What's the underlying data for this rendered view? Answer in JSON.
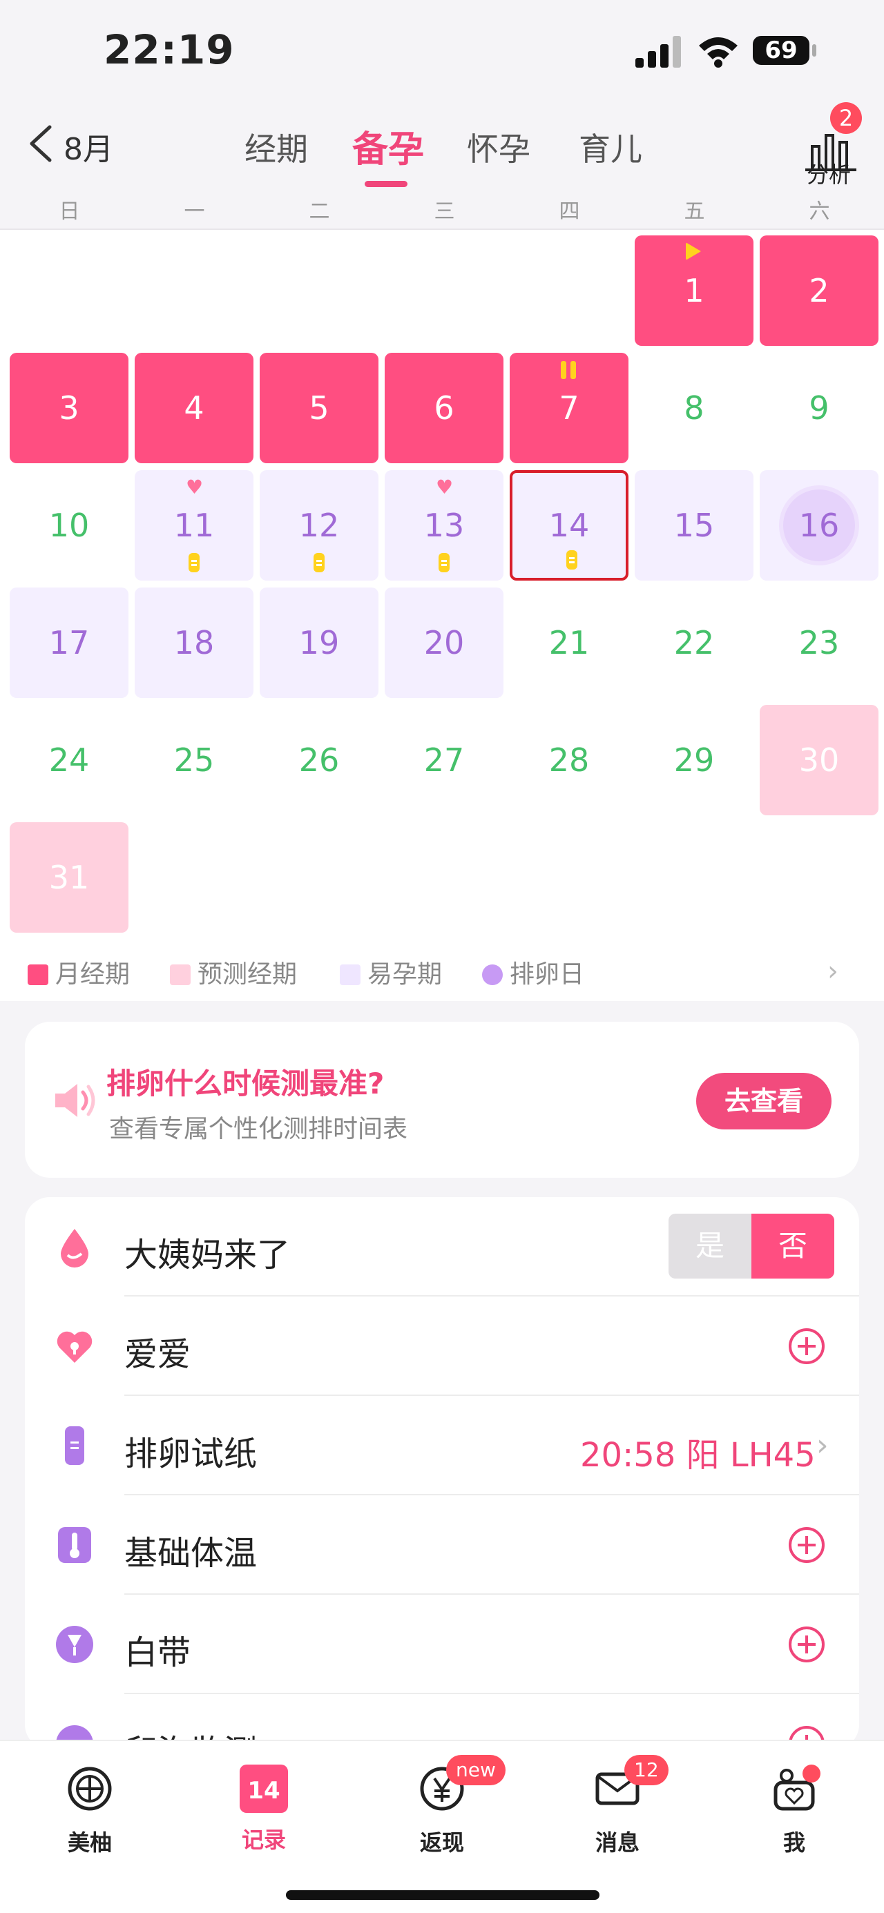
{
  "status_bar": {
    "time": "22:19",
    "battery": "69"
  },
  "nav": {
    "back_label": "8月",
    "tabs": [
      {
        "label": "经期",
        "active": false
      },
      {
        "label": "备孕",
        "active": true
      },
      {
        "label": "怀孕",
        "active": false
      },
      {
        "label": "育儿",
        "active": false
      }
    ],
    "analysis_label": "分析",
    "analysis_badge": "2"
  },
  "weekdays": [
    "日",
    "一",
    "二",
    "三",
    "四",
    "五",
    "六"
  ],
  "calendar": {
    "days": [
      {
        "d": "1",
        "type": "period",
        "mark": "flag"
      },
      {
        "d": "2",
        "type": "period"
      },
      {
        "d": "3",
        "type": "period"
      },
      {
        "d": "4",
        "type": "period"
      },
      {
        "d": "5",
        "type": "period"
      },
      {
        "d": "6",
        "type": "period"
      },
      {
        "d": "7",
        "type": "period",
        "mark": "pause"
      },
      {
        "d": "8",
        "type": "normal"
      },
      {
        "d": "9",
        "type": "normal"
      },
      {
        "d": "10",
        "type": "normal"
      },
      {
        "d": "11",
        "type": "fertile",
        "heart": true,
        "strip": true
      },
      {
        "d": "12",
        "type": "fertile",
        "strip": true
      },
      {
        "d": "13",
        "type": "fertile",
        "heart": true,
        "strip": true
      },
      {
        "d": "14",
        "type": "fertile",
        "strip": true,
        "today": true
      },
      {
        "d": "15",
        "type": "fertile"
      },
      {
        "d": "16",
        "type": "fertile",
        "ovulation": true
      },
      {
        "d": "17",
        "type": "fertile"
      },
      {
        "d": "18",
        "type": "fertile"
      },
      {
        "d": "19",
        "type": "fertile"
      },
      {
        "d": "20",
        "type": "fertile"
      },
      {
        "d": "21",
        "type": "normal"
      },
      {
        "d": "22",
        "type": "normal"
      },
      {
        "d": "23",
        "type": "normal"
      },
      {
        "d": "24",
        "type": "normal"
      },
      {
        "d": "25",
        "type": "normal"
      },
      {
        "d": "26",
        "type": "normal"
      },
      {
        "d": "27",
        "type": "normal"
      },
      {
        "d": "28",
        "type": "normal"
      },
      {
        "d": "29",
        "type": "normal"
      },
      {
        "d": "30",
        "type": "predict"
      },
      {
        "d": "31",
        "type": "predict"
      }
    ],
    "first_weekday": 5
  },
  "legend": [
    {
      "label": "月经期",
      "color": "#ff4e81"
    },
    {
      "label": "预测经期",
      "color": "#ffd0de"
    },
    {
      "label": "易孕期",
      "color": "#efe6ff"
    },
    {
      "label": "排卵日",
      "color": "#c79af4"
    }
  ],
  "promo": {
    "title": "排卵什么时候测最准?",
    "subtitle": "查看专属个性化测排时间表",
    "button": "去查看"
  },
  "records": {
    "period": {
      "label": "大姨妈来了",
      "yes": "是",
      "no": "否"
    },
    "love": {
      "label": "爱爱"
    },
    "ovulation_test": {
      "label": "排卵试纸",
      "value": "20:58 阳 LH45"
    },
    "bbt": {
      "label": "基础体温"
    },
    "discharge": {
      "label": "白带"
    },
    "follicle": {
      "label": "卵泡监测"
    }
  },
  "tabbar": [
    {
      "label": "美柚",
      "icon": "grapefruit-icon",
      "active": false
    },
    {
      "label": "记录",
      "icon": "calendar-14-icon",
      "active": true,
      "icon_text": "14"
    },
    {
      "label": "返现",
      "icon": "yen-icon",
      "active": false,
      "badge": "new"
    },
    {
      "label": "消息",
      "icon": "mail-icon",
      "active": false,
      "badge": "12"
    },
    {
      "label": "我",
      "icon": "profile-icon",
      "active": false,
      "dot": true
    }
  ],
  "colors": {
    "accent": "#f0457a",
    "period": "#ff4e81",
    "fertile_text": "#a06ad6",
    "normal_text": "#45c06a"
  }
}
